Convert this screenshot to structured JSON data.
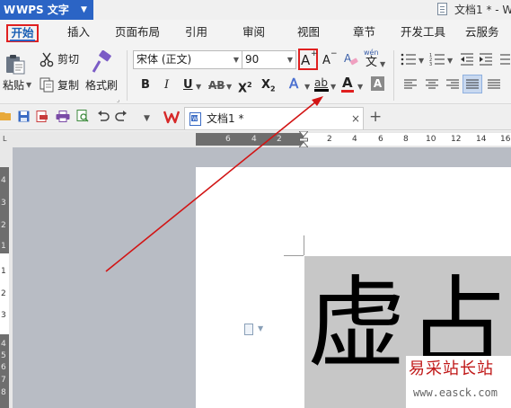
{
  "app": {
    "logo": "W",
    "name": "WPS 文字",
    "window_title": "文档1 * - W"
  },
  "tabs": [
    {
      "label": "开始",
      "active": true
    },
    {
      "label": "插入"
    },
    {
      "label": "页面布局"
    },
    {
      "label": "引用"
    },
    {
      "label": "审阅"
    },
    {
      "label": "视图"
    },
    {
      "label": "章节"
    },
    {
      "label": "开发工具"
    },
    {
      "label": "云服务"
    }
  ],
  "ribbon": {
    "paste_label": "粘贴",
    "cut_label": "剪切",
    "copy_label": "复制",
    "format_painter_label": "格式刷",
    "font_name": "宋体 (正文)",
    "font_size": "90",
    "grow_font": "A",
    "shrink_font": "A",
    "bold": "B",
    "italic": "I",
    "underline": "U",
    "strikethrough": "AB",
    "superscript": "X",
    "subscript": "X",
    "text_effect": "A",
    "highlight": "ab",
    "font_color": "A",
    "char_shading": "A",
    "phonetic": "wén"
  },
  "document_tab": {
    "label": "文档1 *",
    "close": "×",
    "new": "+"
  },
  "ruler": {
    "h_left_ticks": [
      "6",
      "4",
      "2"
    ],
    "h_right_ticks": [
      "2",
      "4",
      "6",
      "8",
      "10",
      "12",
      "14",
      "16"
    ],
    "v_ticks": [
      "4",
      "3",
      "2",
      "1",
      "1",
      "2",
      "3",
      "4",
      "5",
      "6",
      "7",
      "8"
    ]
  },
  "document": {
    "content": "虚占"
  },
  "watermark": {
    "text": "易采站长站",
    "url": "www.easck.com"
  },
  "colors": {
    "app_blue": "#2b64c5",
    "highlight_red": "#e02020",
    "arrow_red": "#d21414",
    "watermark_red": "#c01818",
    "font_color_red": "#e02020"
  }
}
